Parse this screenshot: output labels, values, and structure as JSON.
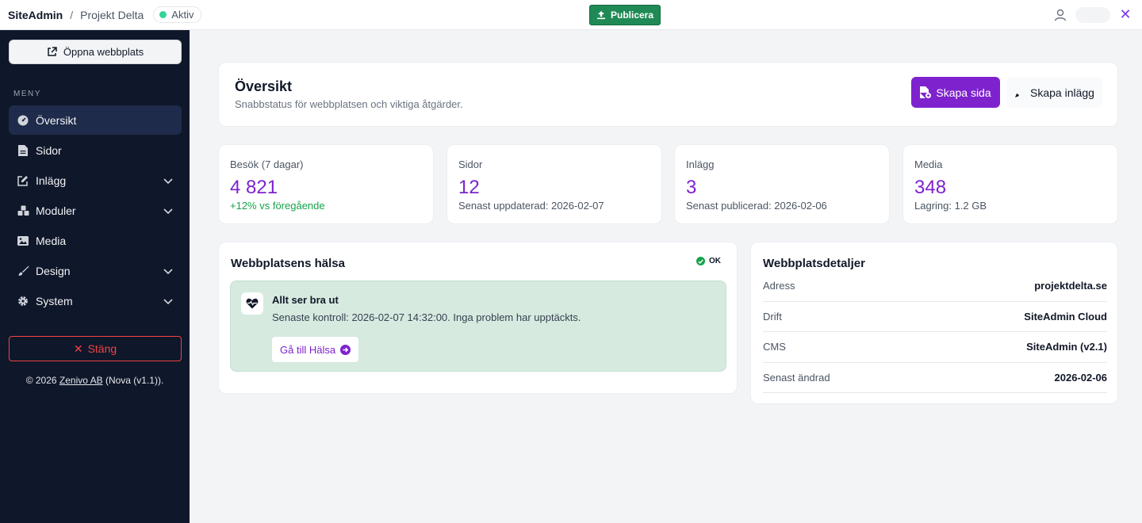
{
  "topbar": {
    "brand": "SiteAdmin",
    "separator": "/",
    "project": "Projekt Delta",
    "status": "Aktiv",
    "publish_label": "Publicera"
  },
  "sidebar": {
    "open_site_label": "Öppna webbplats",
    "menu_heading": "MENY",
    "items": [
      {
        "label": "Översikt",
        "icon": "dashboard-icon",
        "active": true,
        "has_children": false
      },
      {
        "label": "Sidor",
        "icon": "file-icon",
        "active": false,
        "has_children": false
      },
      {
        "label": "Inlägg",
        "icon": "edit-icon",
        "active": false,
        "has_children": true
      },
      {
        "label": "Moduler",
        "icon": "cubes-icon",
        "active": false,
        "has_children": true
      },
      {
        "label": "Media",
        "icon": "image-icon",
        "active": false,
        "has_children": false
      },
      {
        "label": "Design",
        "icon": "brush-icon",
        "active": false,
        "has_children": true
      },
      {
        "label": "System",
        "icon": "gear-icon",
        "active": false,
        "has_children": true
      }
    ],
    "close_label": "Stäng",
    "footer": {
      "prefix": "© 2026 ",
      "company": "Zenivo AB",
      "suffix": " (Nova (v1.1))."
    }
  },
  "overview": {
    "title": "Översikt",
    "subtitle": "Snabbstatus för webbplatsen och viktiga åtgärder.",
    "create_page_label": "Skapa sida",
    "create_post_label": "Skapa inlägg"
  },
  "stats": [
    {
      "label": "Besök (7 dagar)",
      "value": "4 821",
      "foot": "+12% vs föregående",
      "positive": true
    },
    {
      "label": "Sidor",
      "value": "12",
      "foot": "Senast uppdaterad: 2026-02-07",
      "positive": false
    },
    {
      "label": "Inlägg",
      "value": "3",
      "foot": "Senast publicerad: 2026-02-06",
      "positive": false
    },
    {
      "label": "Media",
      "value": "348",
      "foot": "Lagring: 1.2 GB",
      "positive": false
    }
  ],
  "health": {
    "title": "Webbplatsens hälsa",
    "status": "OK",
    "heading": "Allt ser bra ut",
    "text": "Senaste kontroll: 2026-02-07 14:32:00. Inga problem har upptäckts.",
    "link_label": "Gå till Hälsa"
  },
  "details": {
    "title": "Webbplatsdetaljer",
    "rows": [
      {
        "key": "Adress",
        "value": "projektdelta.se"
      },
      {
        "key": "Drift",
        "value": "SiteAdmin Cloud"
      },
      {
        "key": "CMS",
        "value": "SiteAdmin (v2.1)"
      },
      {
        "key": "Senast ändrad",
        "value": "2026-02-06"
      }
    ]
  },
  "colors": {
    "accent": "#7e22ce",
    "publish": "#1f8a55",
    "sidebar_bg": "#0f172a",
    "danger": "#ef4444",
    "success": "#16a34a"
  }
}
